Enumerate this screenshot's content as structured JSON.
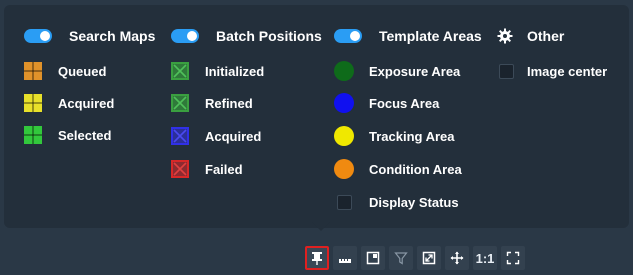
{
  "columns": [
    {
      "header": "Search Maps",
      "items": [
        {
          "label": "Queued",
          "color": "#e0922a"
        },
        {
          "label": "Acquired",
          "color": "#e8e12a"
        },
        {
          "label": "Selected",
          "color": "#32c83c"
        }
      ]
    },
    {
      "header": "Batch Positions",
      "items": [
        {
          "label": "Initialized",
          "color": "#2f7a3a"
        },
        {
          "label": "Refined",
          "color": "#2f7a3a"
        },
        {
          "label": "Acquired",
          "color": "#2b2f9a"
        },
        {
          "label": "Failed",
          "color": "#8e2a30"
        }
      ]
    },
    {
      "header": "Template Areas",
      "items": [
        {
          "label": "Exposure Area",
          "color": "#0e6b1a"
        },
        {
          "label": "Focus Area",
          "color": "#1010f0"
        },
        {
          "label": "Tracking Area",
          "color": "#f0e800"
        },
        {
          "label": "Condition Area",
          "color": "#f08a10"
        },
        {
          "label": "Display Status"
        }
      ]
    },
    {
      "header": "Other",
      "items": [
        {
          "label": "Image center"
        }
      ]
    }
  ],
  "toolbar": {
    "buttons": [
      {
        "icon": "pin-icon",
        "active": true
      },
      {
        "icon": "ruler-icon"
      },
      {
        "icon": "frame-icon"
      },
      {
        "icon": "filter-icon"
      },
      {
        "icon": "resize-icon"
      },
      {
        "icon": "move-icon"
      },
      {
        "icon": "actual-size-icon",
        "label": "1:1"
      },
      {
        "icon": "fit-screen-icon"
      }
    ]
  },
  "accent_color": "#2a9df4"
}
